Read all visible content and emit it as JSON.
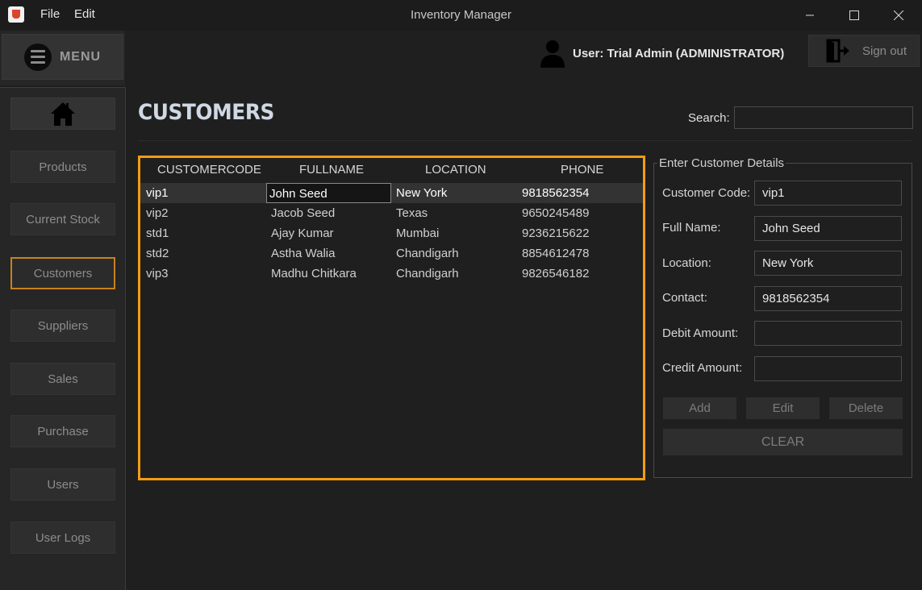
{
  "window": {
    "title": "Inventory Manager",
    "menus": [
      "File",
      "Edit"
    ]
  },
  "menu_button": {
    "label": "MENU"
  },
  "sidebar": {
    "items": [
      {
        "label": "Products"
      },
      {
        "label": "Current Stock"
      },
      {
        "label": "Customers",
        "active": true
      },
      {
        "label": "Suppliers"
      },
      {
        "label": "Sales"
      },
      {
        "label": "Purchase"
      },
      {
        "label": "Users"
      },
      {
        "label": "User Logs"
      }
    ]
  },
  "header": {
    "user_label": "User: Trial Admin (ADMINISTRATOR)",
    "signout_label": "Sign out"
  },
  "page": {
    "title": "CUSTOMERS",
    "search_label": "Search:",
    "search_value": ""
  },
  "table": {
    "columns": [
      "CUSTOMERCODE",
      "FULLNAME",
      "LOCATION",
      "PHONE"
    ],
    "rows": [
      [
        "vip1",
        "John Seed",
        "New York",
        "9818562354"
      ],
      [
        "vip2",
        "Jacob Seed",
        "Texas",
        "9650245489"
      ],
      [
        "std1",
        "Ajay Kumar",
        "Mumbai",
        "9236215622"
      ],
      [
        "std2",
        "Astha Walia",
        "Chandigarh",
        "8854612478"
      ],
      [
        "vip3",
        "Madhu Chitkara",
        "Chandigarh",
        "9826546182"
      ]
    ],
    "selected_row": 0
  },
  "form": {
    "title": "Enter Customer Details",
    "fields": [
      {
        "label": "Customer Code:",
        "value": "vip1"
      },
      {
        "label": "Full Name:",
        "value": "John Seed"
      },
      {
        "label": "Location:",
        "value": "New York"
      },
      {
        "label": "Contact:",
        "value": "9818562354"
      },
      {
        "label": "Debit Amount:",
        "value": ""
      },
      {
        "label": "Credit Amount:",
        "value": ""
      }
    ],
    "buttons": {
      "add": "Add",
      "edit": "Edit",
      "delete": "Delete",
      "clear": "CLEAR"
    }
  },
  "colors": {
    "accent": "#f39c12",
    "background": "#1f1f1f",
    "sidebar": "#262626"
  }
}
